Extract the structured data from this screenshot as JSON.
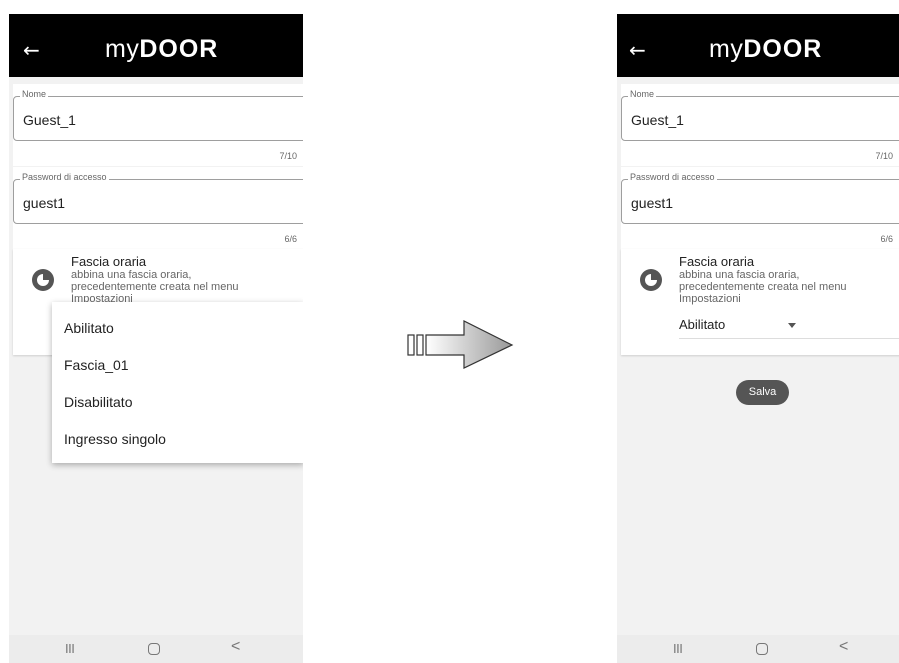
{
  "app": {
    "brand_light": "my",
    "brand_bold": "DOOR",
    "back_icon": "arrow-left-icon"
  },
  "left_screen": {
    "name_field": {
      "legend": "Nome",
      "value": "Guest_1",
      "counter": "7/10"
    },
    "password_field": {
      "legend": "Password di accesso",
      "value": "guest1",
      "counter": "6/6"
    },
    "time_slot": {
      "title": "Fascia oraria",
      "description": "abbina una fascia oraria, precedentemente creata nel menu Impostazioni",
      "icon": "clock-icon"
    },
    "dropdown_menu": {
      "items": [
        "Abilitato",
        "Fascia_01",
        "Disabilitato",
        "Ingresso singolo"
      ]
    }
  },
  "right_screen": {
    "name_field": {
      "legend": "Nome",
      "value": "Guest_1",
      "counter": "7/10"
    },
    "password_field": {
      "legend": "Password di accesso",
      "value": "guest1",
      "counter": "6/6"
    },
    "time_slot": {
      "title": "Fascia oraria",
      "description": "abbina una fascia oraria, precedentemente creata nel menu Impostazioni",
      "icon": "clock-icon",
      "selected": "Abilitato"
    },
    "save_button": "Salva"
  },
  "navbar": {
    "recent_icon": "III",
    "home_icon": "home-icon",
    "back_icon": "<"
  }
}
